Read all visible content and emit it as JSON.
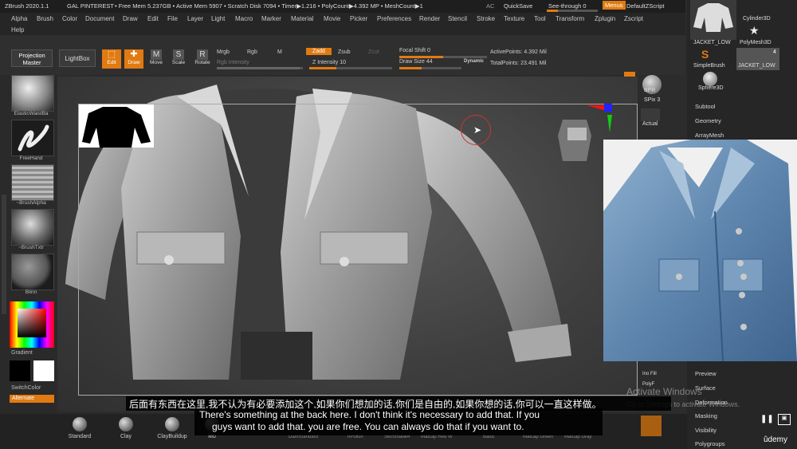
{
  "titlebar": {
    "app": "ZBrush 2020.1.1",
    "document": "GAL PINTEREST",
    "stats": "• Free Mem 5.237GB • Active Mem 5907 • Scratch Disk 7094 • Timer▶1.216 • PolyCount▶4.392 MP • MeshCount▶1",
    "ac": "AC",
    "quicksave": "QuickSave",
    "seethrough": "See-through  0",
    "menus": "Menus",
    "zscript": "DefaultZScript"
  },
  "menu": [
    "Alpha",
    "Brush",
    "Color",
    "Document",
    "Draw",
    "Edit",
    "File",
    "Layer",
    "Light",
    "Macro",
    "Marker",
    "Material",
    "Movie",
    "Picker",
    "Preferences",
    "Render",
    "Stencil",
    "Stroke",
    "Texture",
    "Tool",
    "Transform",
    "Zplugin",
    "Zscript",
    "Help"
  ],
  "toolbar": {
    "projection_master": "Projection Master",
    "lightbox": "LightBox",
    "edit": "Edit",
    "draw": "Draw",
    "move": "Move",
    "scale": "Scale",
    "rotate": "Rotate",
    "mrgb": "Mrgb",
    "rgb": "Rgb",
    "m": "M",
    "rgb_intensity": "Rgb Intensity",
    "zadd": "Zadd",
    "zsub": "Zsub",
    "zcut": "Zcut",
    "z_intensity": "Z Intensity 10",
    "focal_shift": "Focal Shift 0",
    "draw_size": "Draw Size 44",
    "dynamic": "Dynamic",
    "active_points": "ActivePoints: 4.392 Mil",
    "total_points": "TotalPoints: 23.491 Mil"
  },
  "leftshelf": {
    "brush1": "ElasticWaistBa",
    "stroke": "FreeHand",
    "alpha": "~BrushAlpha",
    "texture": "~BrushTxtr",
    "material": "Blinn",
    "gradient": "Gradient",
    "switchcolor": "SwitchColor",
    "alternate": "Alternate"
  },
  "rightshelf": {
    "bpr": "BPR",
    "spix": "SPix 3",
    "actual": "Actual"
  },
  "tray": {
    "jacket_low": "JACKET_LOW",
    "cylinder": "Cylinder3D",
    "polymesh": "PolyMesh3D",
    "simplebrush": "SimpleBrush",
    "jacket_low2": "JACKET_LOW",
    "count": "4",
    "sphere": "Sphere3D",
    "items_top": [
      "Subtool",
      "Geometry",
      "ArrayMesh"
    ],
    "items_bottom": [
      "Preview",
      "Surface",
      "Deformation",
      "Masking",
      "Visibility",
      "Polygroups"
    ]
  },
  "right_extra": {
    "inifill": "Ino Fill",
    "polyf": "PolyF"
  },
  "bottom": {
    "brushes": [
      "Standard",
      "Clay",
      "ClayBuildup",
      "Mo"
    ],
    "faded": [
      "DamStandard",
      "hPolish",
      "SkinShade4",
      "Matcap Red W",
      "Basic",
      "Matcap Green",
      "Matcap Gray"
    ]
  },
  "watermark": {
    "line1": "Activate Windows",
    "line2": "Go to Settings to activate Windows.",
    "udemy": "ûdemy"
  },
  "subtitles": {
    "zh": "后面有东西在这里,我不认为有必要添加这个,如果你们想加的话,你们是自由的,如果你想的话,你可以一直这样做。",
    "en1": "There's something at the back here. I don't think it's necessary to add that. If you",
    "en2": "guys want to add that. you are free. You can always do that if you want to."
  },
  "colors": {
    "accent": "#e07b12",
    "panel": "#2f2f2f",
    "canvas": "#4a4a4a"
  }
}
